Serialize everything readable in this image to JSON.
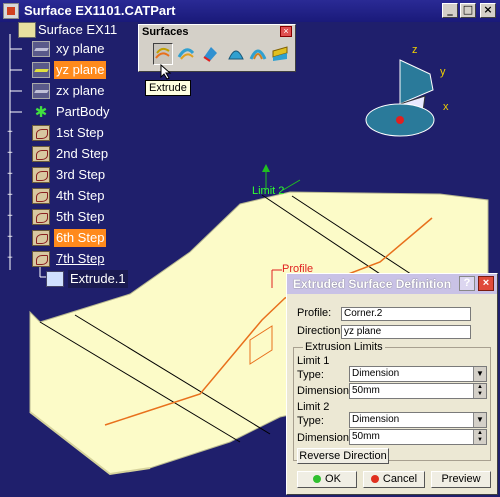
{
  "window": {
    "title": "Surface EX1101.CATPart"
  },
  "tree": {
    "root": "Surface EX11",
    "items": [
      {
        "label": "xy plane",
        "icon": "plane-icon"
      },
      {
        "label": "yz plane",
        "icon": "plane-icon",
        "selected": true
      },
      {
        "label": "zx plane",
        "icon": "plane-icon"
      },
      {
        "label": "PartBody",
        "icon": "partbody-icon"
      },
      {
        "label": "1st Step",
        "icon": "geometrical-set-icon"
      },
      {
        "label": "2nd Step",
        "icon": "geometrical-set-icon"
      },
      {
        "label": "3rd Step",
        "icon": "geometrical-set-icon"
      },
      {
        "label": "4th Step",
        "icon": "geometrical-set-icon"
      },
      {
        "label": "5th Step",
        "icon": "geometrical-set-icon"
      },
      {
        "label": "6th Step",
        "icon": "geometrical-set-icon",
        "selected": true
      },
      {
        "label": "7th Step",
        "icon": "geometrical-set-icon"
      },
      {
        "label": "Extrude.1",
        "icon": "extrude-icon"
      }
    ]
  },
  "toolbar": {
    "title": "Surfaces",
    "tooltip": "Extrude",
    "buttons": [
      "extrude-icon",
      "offset-icon",
      "sweep-icon",
      "fill-icon",
      "multi-section-icon",
      "blend-icon"
    ]
  },
  "scene": {
    "labels": {
      "limit": "Limit 2",
      "profile": "Profile"
    },
    "axes": {
      "z": "z",
      "y": "y",
      "x": "x"
    },
    "colors": {
      "surface": "#fcfbc8",
      "profile_curve": "#e8701c",
      "background": "#1f1f6c"
    }
  },
  "dialog": {
    "title": "Extruded Surface Definition",
    "profile_label": "Profile:",
    "profile_value": "Corner.2",
    "direction_label": "Direction:",
    "direction_value": "yz plane",
    "limits_group": "Extrusion Limits",
    "limit1": {
      "title": "Limit 1",
      "type_label": "Type:",
      "type_value": "Dimension",
      "dim_label": "Dimension:",
      "dim_value": "50mm"
    },
    "limit2": {
      "title": "Limit 2",
      "type_label": "Type:",
      "type_value": "Dimension",
      "dim_label": "Dimension:",
      "dim_value": "50mm"
    },
    "reverse_button": "Reverse Direction",
    "ok_button": "OK",
    "cancel_button": "Cancel",
    "preview_button": "Preview"
  }
}
